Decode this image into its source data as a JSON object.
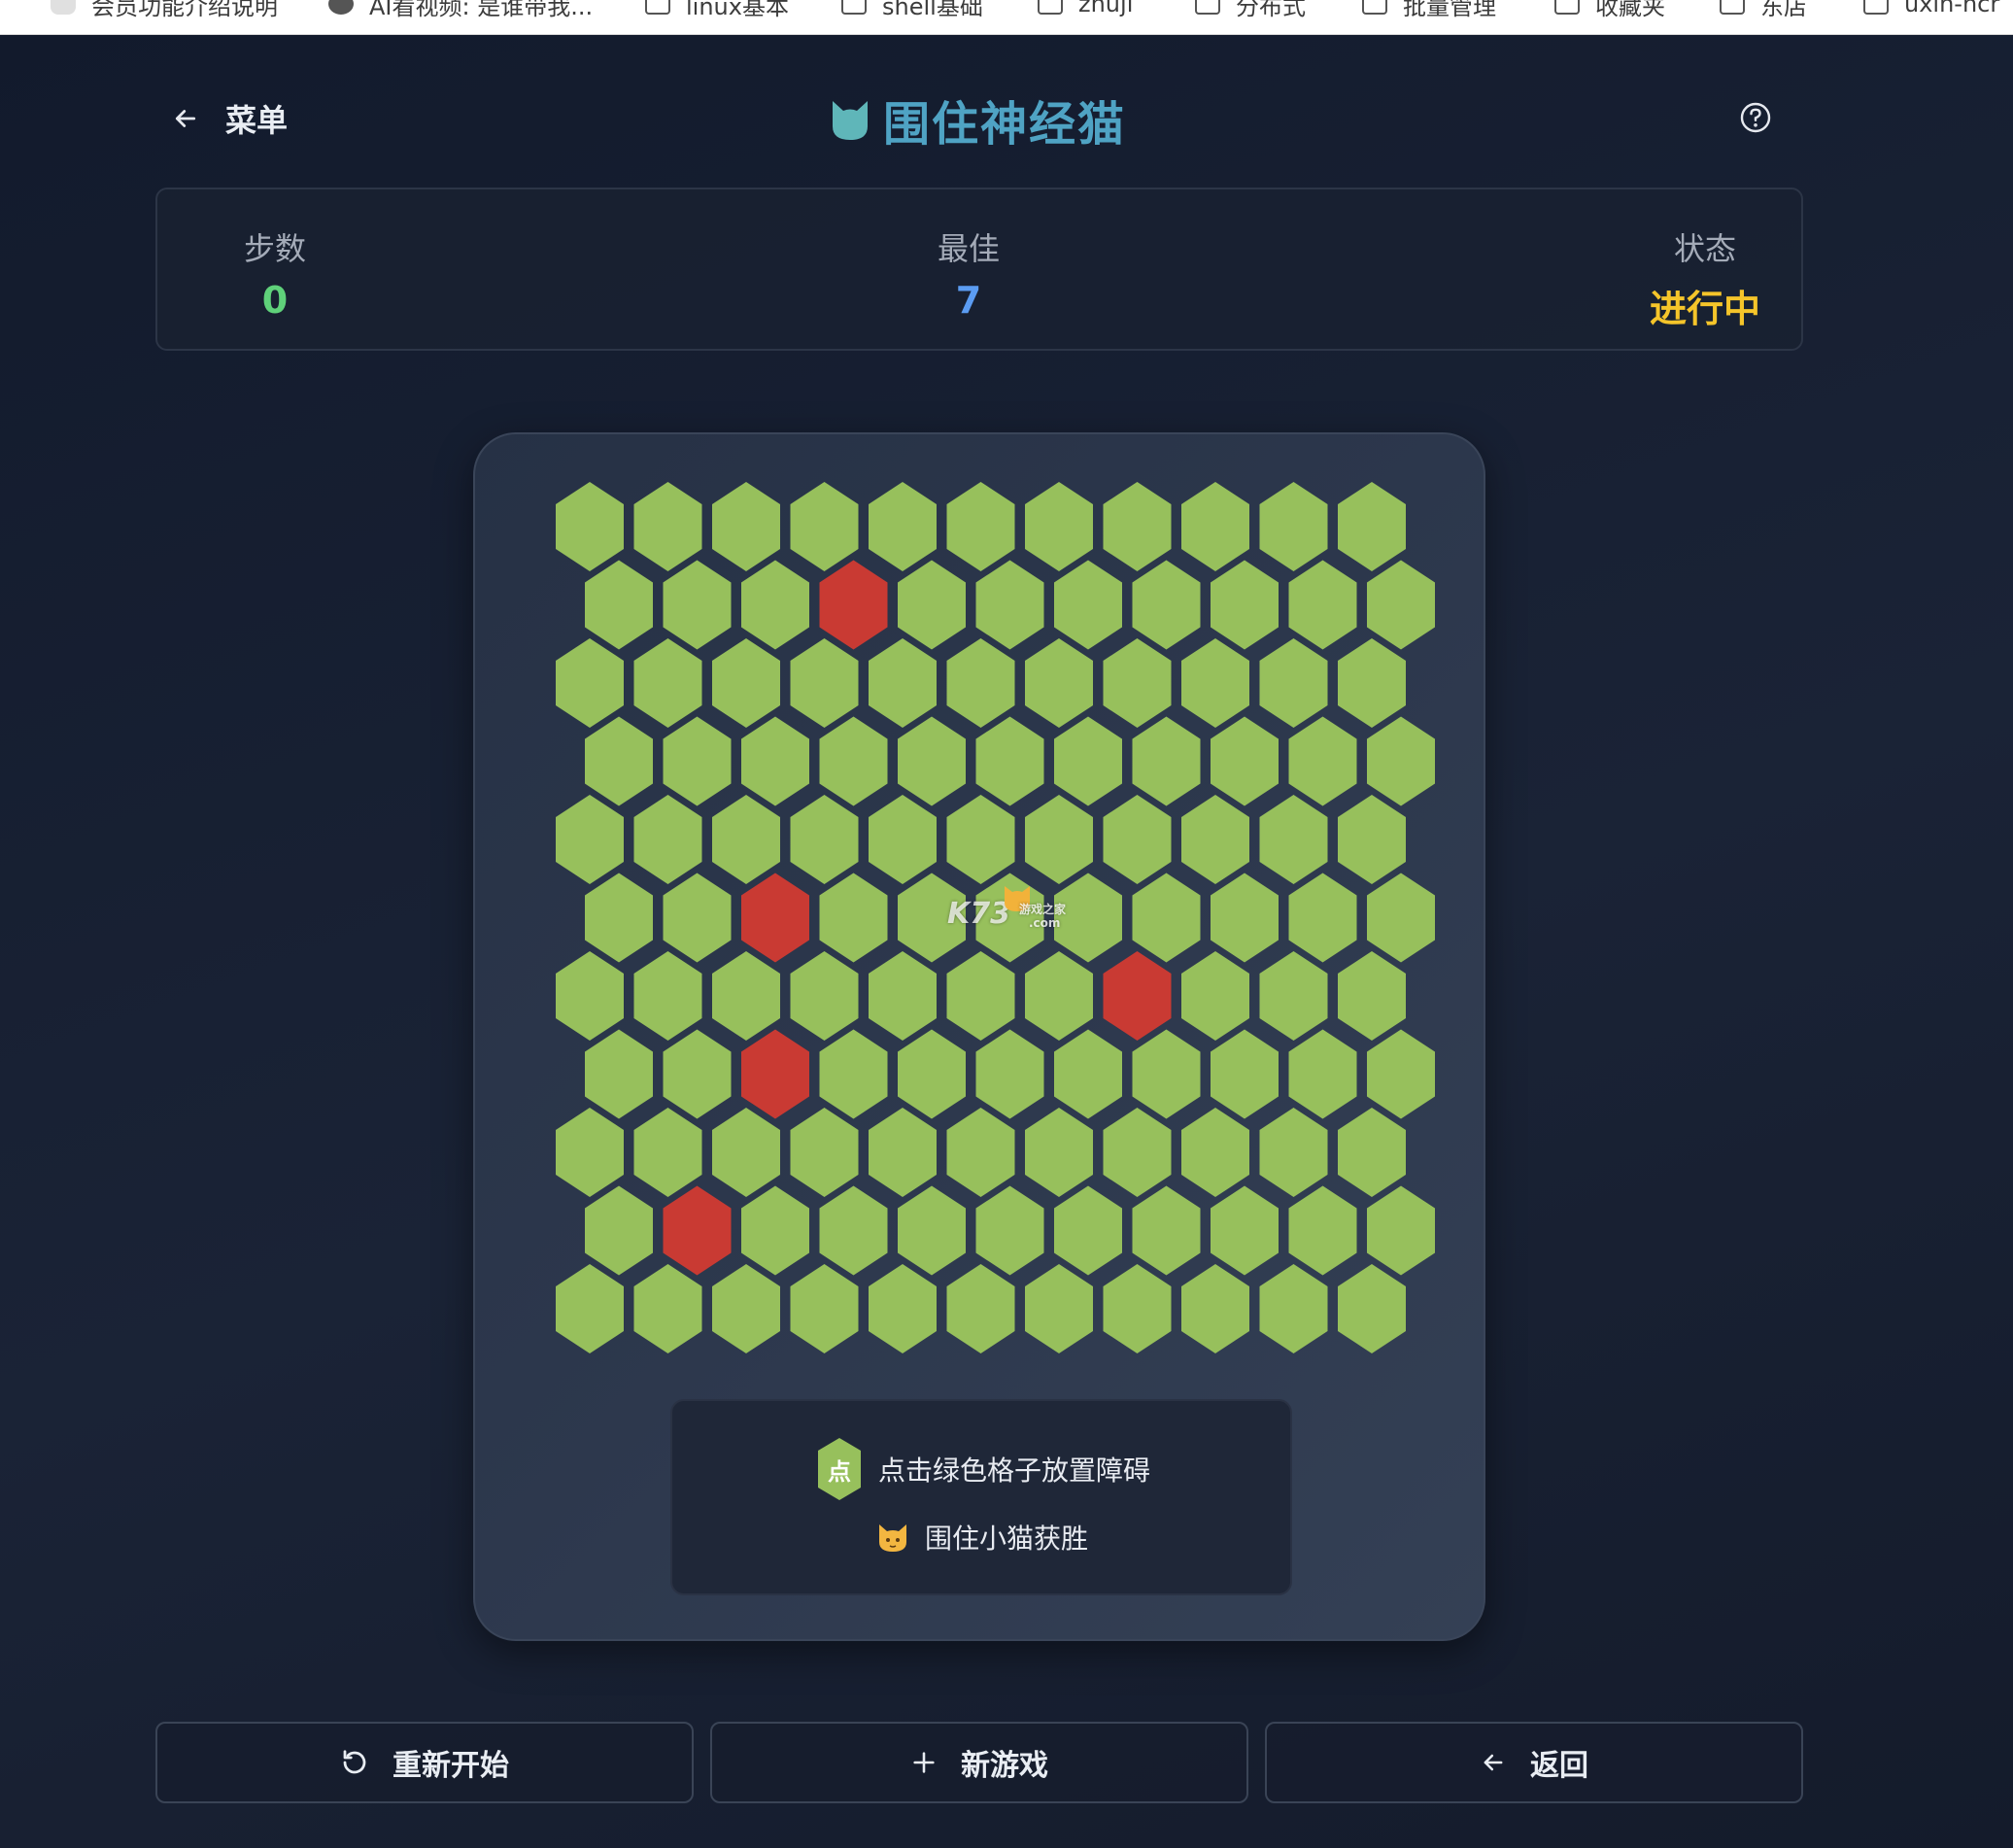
{
  "browser": {
    "bookmarks": [
      {
        "label": "会员功能介绍说明",
        "icon": "bubble-icon"
      },
      {
        "label": "AI看视频: 是谁带我...",
        "icon": "globe-icon"
      },
      {
        "label": "linux基本",
        "icon": "folder-icon"
      },
      {
        "label": "shell基础",
        "icon": "folder-icon"
      },
      {
        "label": "zhuji",
        "icon": "folder-icon"
      },
      {
        "label": "分布式",
        "icon": "folder-icon"
      },
      {
        "label": "批量管理",
        "icon": "folder-icon"
      },
      {
        "label": "收藏夹",
        "icon": "folder-icon"
      },
      {
        "label": "东店",
        "icon": "folder-icon"
      },
      {
        "label": "uxin-ncr",
        "icon": "folder-icon"
      }
    ]
  },
  "header": {
    "menu_label": "菜单",
    "title": "围住神经猫",
    "title_color": "#4fa3c4",
    "help_icon": "question-circle-icon"
  },
  "stats": {
    "steps": {
      "label": "步数",
      "value": "0",
      "color": "#5fd17a"
    },
    "best": {
      "label": "最佳",
      "value": "7",
      "color": "#5b9cf2"
    },
    "status": {
      "label": "状态",
      "value": "进行中",
      "color": "#f5c52a"
    }
  },
  "board": {
    "rows": 11,
    "cols": 11,
    "cell_color": "#97c05c",
    "blocked_color": "#c93a33",
    "blocked": [
      [
        1,
        3
      ],
      [
        5,
        2
      ],
      [
        6,
        7
      ],
      [
        7,
        2
      ],
      [
        9,
        1
      ]
    ],
    "watermark": {
      "main": "K73",
      "sub": "游戏之家",
      "domain": ".com"
    }
  },
  "help": {
    "row1_badge": "点",
    "row1_text": "点击绿色格子放置障碍",
    "row2_text": "围住小猫获胜"
  },
  "buttons": {
    "restart": "重新开始",
    "new_game": "新游戏",
    "back": "返回"
  }
}
